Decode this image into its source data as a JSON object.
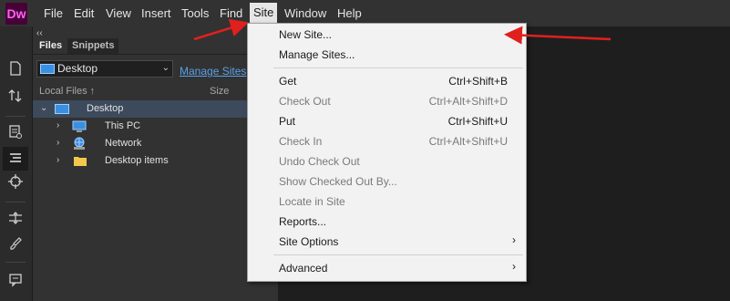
{
  "app": {
    "logo": "Dw",
    "accent": "#ff61f6",
    "logo_bg": "#470137"
  },
  "menubar": [
    "File",
    "Edit",
    "View",
    "Insert",
    "Tools",
    "Find",
    "Site",
    "Window",
    "Help"
  ],
  "active_menu": "Site",
  "toolbar_icons": [
    "collapse-icon",
    "new-file-icon",
    "sort-icon",
    "preview-icon",
    "outline-icon",
    "target-icon",
    "expand-icon",
    "brush-icon",
    "comment-icon"
  ],
  "files_panel": {
    "collapse_glyph": "‹‹",
    "tabs": [
      "Files",
      "Snippets"
    ],
    "site_select": "Desktop",
    "manage_sites": "Manage Sites",
    "columns": {
      "name": "Local Files",
      "sort_glyph": "↑",
      "size": "Size"
    },
    "tree": [
      {
        "label": "Desktop",
        "expanded": true,
        "level": 0,
        "icon": "desktop-icon"
      },
      {
        "label": "This PC",
        "expanded": false,
        "level": 1,
        "icon": "computer-icon"
      },
      {
        "label": "Network",
        "expanded": false,
        "level": 1,
        "icon": "network-icon"
      },
      {
        "label": "Desktop items",
        "expanded": false,
        "level": 1,
        "icon": "folder-icon"
      }
    ]
  },
  "site_menu": {
    "items": [
      {
        "label": "New Site...",
        "enabled": true
      },
      {
        "label": "Manage Sites...",
        "enabled": true
      },
      {
        "label": "Get",
        "shortcut": "Ctrl+Shift+B",
        "enabled": true
      },
      {
        "label": "Check Out",
        "shortcut": "Ctrl+Alt+Shift+D",
        "enabled": false
      },
      {
        "label": "Put",
        "shortcut": "Ctrl+Shift+U",
        "enabled": true
      },
      {
        "label": "Check In",
        "shortcut": "Ctrl+Alt+Shift+U",
        "enabled": false
      },
      {
        "label": "Undo Check Out",
        "enabled": false
      },
      {
        "label": "Show Checked Out By...",
        "enabled": false
      },
      {
        "label": "Locate in Site",
        "enabled": false
      },
      {
        "label": "Reports...",
        "enabled": true
      },
      {
        "label": "Site Options",
        "submenu": true,
        "enabled": true
      },
      {
        "label": "Advanced",
        "submenu": true,
        "enabled": true
      }
    ],
    "submenu_glyph": "›"
  },
  "annotation_color": "#e0201e"
}
